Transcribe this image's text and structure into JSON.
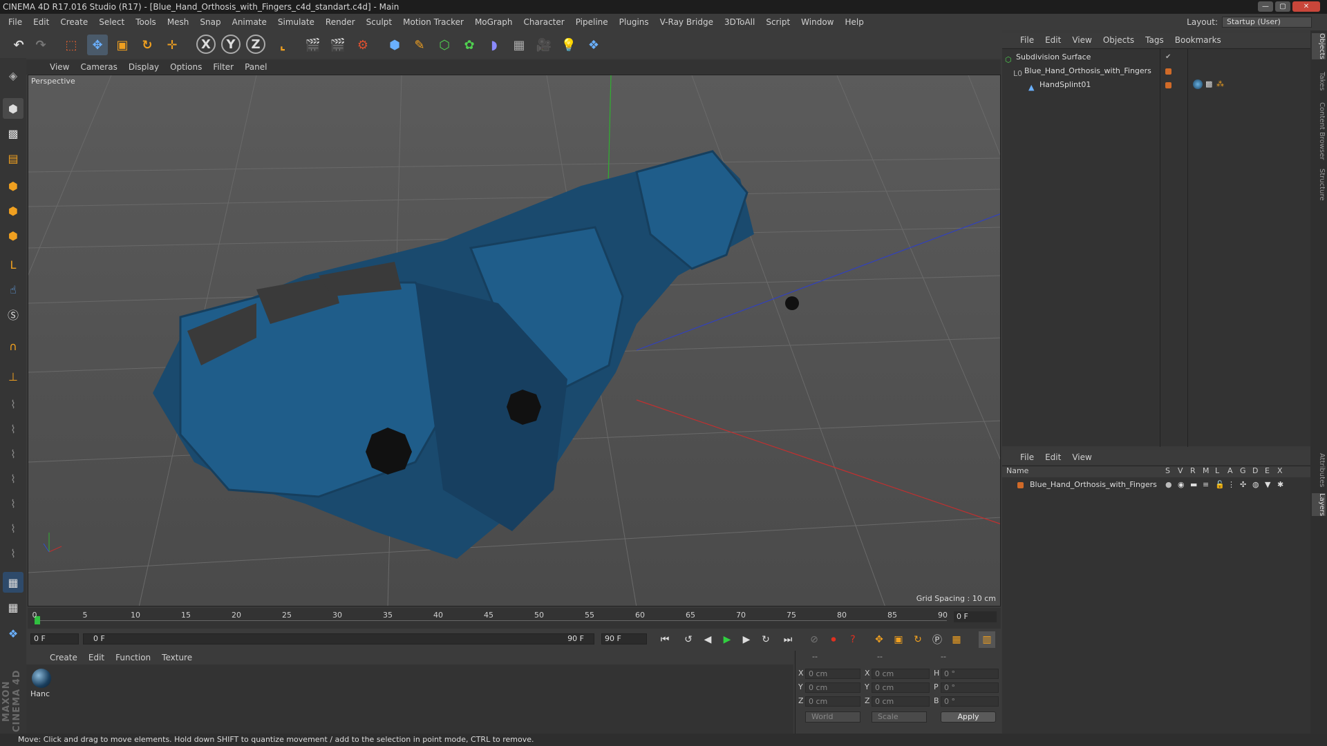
{
  "window": {
    "title": "CINEMA 4D R17.016 Studio (R17) - [Blue_Hand_Orthosis_with_Fingers_c4d_standart.c4d] - Main",
    "controls": [
      "minimize",
      "restore",
      "close"
    ]
  },
  "menubar": {
    "items": [
      "File",
      "Edit",
      "Create",
      "Select",
      "Tools",
      "Mesh",
      "Snap",
      "Animate",
      "Simulate",
      "Render",
      "Sculpt",
      "Motion Tracker",
      "MoGraph",
      "Character",
      "Pipeline",
      "Plugins",
      "V-Ray Bridge",
      "3DToAll",
      "Script",
      "Window",
      "Help"
    ],
    "layout_label": "Layout:",
    "layout_value": "Startup (User)"
  },
  "toolbar": {
    "axis_x": "X",
    "axis_y": "Y",
    "axis_z": "Z"
  },
  "viewport": {
    "menu": [
      "View",
      "Cameras",
      "Display",
      "Options",
      "Filter",
      "Panel"
    ],
    "label": "Perspective",
    "grid_spacing": "Grid Spacing : 10 cm"
  },
  "timeline": {
    "ticks": [
      "0",
      "5",
      "10",
      "15",
      "20",
      "25",
      "30",
      "35",
      "40",
      "45",
      "50",
      "55",
      "60",
      "65",
      "70",
      "75",
      "80",
      "85",
      "90"
    ],
    "current_frame": "0 F"
  },
  "transport": {
    "start": "0 F",
    "range_start": "0 F",
    "range_end": "90 F",
    "end": "90 F"
  },
  "material": {
    "menu": [
      "Create",
      "Edit",
      "Function",
      "Texture"
    ],
    "name": "Hanc"
  },
  "coordinates": {
    "headers": [
      "--",
      "--",
      "--"
    ],
    "rows": [
      {
        "axis": "X",
        "pos": "0 cm",
        "axis2": "X",
        "size": "0 cm",
        "axis3": "H",
        "rot": "0 °"
      },
      {
        "axis": "Y",
        "pos": "0 cm",
        "axis2": "Y",
        "size": "0 cm",
        "axis3": "P",
        "rot": "0 °"
      },
      {
        "axis": "Z",
        "pos": "0 cm",
        "axis2": "Z",
        "size": "0 cm",
        "axis3": "B",
        "rot": "0 °"
      }
    ],
    "space": "World",
    "mode": "Scale",
    "apply": "Apply"
  },
  "objects": {
    "menu": [
      "File",
      "Edit",
      "View",
      "Objects",
      "Tags",
      "Bookmarks"
    ],
    "items": [
      {
        "name": "Subdivision Surface"
      },
      {
        "name": "Blue_Hand_Orthosis_with_Fingers"
      },
      {
        "name": "HandSplint01"
      }
    ]
  },
  "layers": {
    "menu": [
      "File",
      "Edit",
      "View"
    ],
    "columns": [
      "Name",
      "S",
      "V",
      "R",
      "M",
      "L",
      "A",
      "G",
      "D",
      "E",
      "X"
    ],
    "rows": [
      {
        "name": "Blue_Hand_Orthosis_with_Fingers"
      }
    ]
  },
  "right_tabs": [
    "Objects",
    "Takes",
    "Content Browser",
    "Structure",
    "Attributes",
    "Layers"
  ],
  "status": "Move: Click and drag to move elements. Hold down SHIFT to quantize movement / add to the selection in point mode, CTRL to remove.",
  "branding": "MAXON CINEMA 4D",
  "colors": {
    "accent_orange": "#d06a28",
    "orthosis_blue": "#1f5d8a",
    "axis_x": "#c03030",
    "axis_y": "#30b030",
    "axis_z": "#3050d0"
  }
}
